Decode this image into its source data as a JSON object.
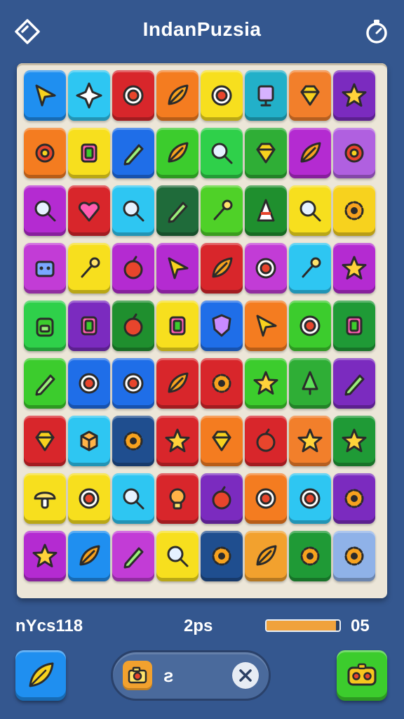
{
  "header": {
    "title": "IndanPuzsia",
    "left_icon": "diamond-back-icon",
    "right_icon": "timer-icon"
  },
  "board": {
    "rows": 9,
    "cols": 8,
    "tiles": [
      [
        {
          "color": "#1f8ff0",
          "icon": "arrow"
        },
        {
          "color": "#2ec6f2",
          "icon": "sparkle"
        },
        {
          "color": "#d8262b",
          "icon": "ring"
        },
        {
          "color": "#f47c20",
          "icon": "leaf"
        },
        {
          "color": "#f7df1e",
          "icon": "ring"
        },
        {
          "color": "#22b0c9",
          "icon": "trophy"
        },
        {
          "color": "#f27f2b",
          "icon": "gem"
        },
        {
          "color": "#7b2bbf",
          "icon": "star"
        }
      ],
      [
        {
          "color": "#f47c20",
          "icon": "flower"
        },
        {
          "color": "#f7df1e",
          "icon": "square"
        },
        {
          "color": "#1f6ee8",
          "icon": "pencil"
        },
        {
          "color": "#3ccc2d",
          "icon": "leaf"
        },
        {
          "color": "#2fd04a",
          "icon": "magnifier"
        },
        {
          "color": "#2fae36",
          "icon": "gem"
        },
        {
          "color": "#b42bd1",
          "icon": "leaf"
        },
        {
          "color": "#b060e0",
          "icon": "flower"
        }
      ],
      [
        {
          "color": "#b42bd1",
          "icon": "magnifier"
        },
        {
          "color": "#d8262b",
          "icon": "heart"
        },
        {
          "color": "#2ec6f2",
          "icon": "magnifier"
        },
        {
          "color": "#1f6b3a",
          "icon": "pencil"
        },
        {
          "color": "#4fd128",
          "icon": "wand"
        },
        {
          "color": "#1f8f2e",
          "icon": "cone"
        },
        {
          "color": "#f7df1e",
          "icon": "magnifier"
        },
        {
          "color": "#f7d21e",
          "icon": "gear"
        }
      ],
      [
        {
          "color": "#c23cd6",
          "icon": "robot"
        },
        {
          "color": "#f7df1e",
          "icon": "wand"
        },
        {
          "color": "#b42bd1",
          "icon": "berry"
        },
        {
          "color": "#b42bd1",
          "icon": "arrow"
        },
        {
          "color": "#d8262b",
          "icon": "leaf"
        },
        {
          "color": "#c23cd6",
          "icon": "ring"
        },
        {
          "color": "#2ec6f2",
          "icon": "wand"
        },
        {
          "color": "#b42bd1",
          "icon": "star"
        }
      ],
      [
        {
          "color": "#2fd04a",
          "icon": "backpack"
        },
        {
          "color": "#7b2bbf",
          "icon": "square"
        },
        {
          "color": "#1f8f2e",
          "icon": "berry"
        },
        {
          "color": "#f7df1e",
          "icon": "square"
        },
        {
          "color": "#1f6ee8",
          "icon": "shield"
        },
        {
          "color": "#f47c20",
          "icon": "arrow"
        },
        {
          "color": "#3ccc2d",
          "icon": "ring"
        },
        {
          "color": "#1f9a36",
          "icon": "square"
        }
      ],
      [
        {
          "color": "#3ccc2d",
          "icon": "pencil"
        },
        {
          "color": "#1f6ee8",
          "icon": "ring"
        },
        {
          "color": "#1f6ee8",
          "icon": "ring"
        },
        {
          "color": "#d8262b",
          "icon": "leaf"
        },
        {
          "color": "#d8262b",
          "icon": "gear"
        },
        {
          "color": "#3ccc2d",
          "icon": "star"
        },
        {
          "color": "#2fae36",
          "icon": "tree"
        },
        {
          "color": "#7b2bbf",
          "icon": "pencil"
        }
      ],
      [
        {
          "color": "#d8262b",
          "icon": "gem"
        },
        {
          "color": "#2ec6f2",
          "icon": "cube"
        },
        {
          "color": "#1f4e8f",
          "icon": "gear"
        },
        {
          "color": "#d8262b",
          "icon": "star"
        },
        {
          "color": "#f47c20",
          "icon": "gem"
        },
        {
          "color": "#d8262b",
          "icon": "berry"
        },
        {
          "color": "#f27f2b",
          "icon": "star"
        },
        {
          "color": "#1f9a36",
          "icon": "star"
        }
      ],
      [
        {
          "color": "#f7df1e",
          "icon": "mushroom"
        },
        {
          "color": "#f7df1e",
          "icon": "ring"
        },
        {
          "color": "#2ec6f2",
          "icon": "magnifier"
        },
        {
          "color": "#d8262b",
          "icon": "bulb"
        },
        {
          "color": "#7b2bbf",
          "icon": "berry"
        },
        {
          "color": "#f47c20",
          "icon": "ring"
        },
        {
          "color": "#2ec6f2",
          "icon": "ring"
        },
        {
          "color": "#7b2bbf",
          "icon": "gear"
        }
      ],
      [
        {
          "color": "#b42bd1",
          "icon": "star"
        },
        {
          "color": "#1f8ff0",
          "icon": "leaf"
        },
        {
          "color": "#c23cd6",
          "icon": "pencil"
        },
        {
          "color": "#f7df1e",
          "icon": "magnifier"
        },
        {
          "color": "#1f4e8f",
          "icon": "gear"
        },
        {
          "color": "#f2a12e",
          "icon": "leaf"
        },
        {
          "color": "#1f9a36",
          "icon": "gear"
        },
        {
          "color": "#8fb2e8",
          "icon": "gear"
        }
      ]
    ]
  },
  "status": {
    "left_text": "nYcs118",
    "center_text": "2ps",
    "right_text": "05",
    "progress_fraction": 0.95
  },
  "bottom_bar": {
    "left_button_icon": "leaf-icon",
    "item_icon": "camera-icon",
    "item_count": "ƨ",
    "close_icon": "close-icon",
    "right_button_icon": "gamepad-icon"
  }
}
